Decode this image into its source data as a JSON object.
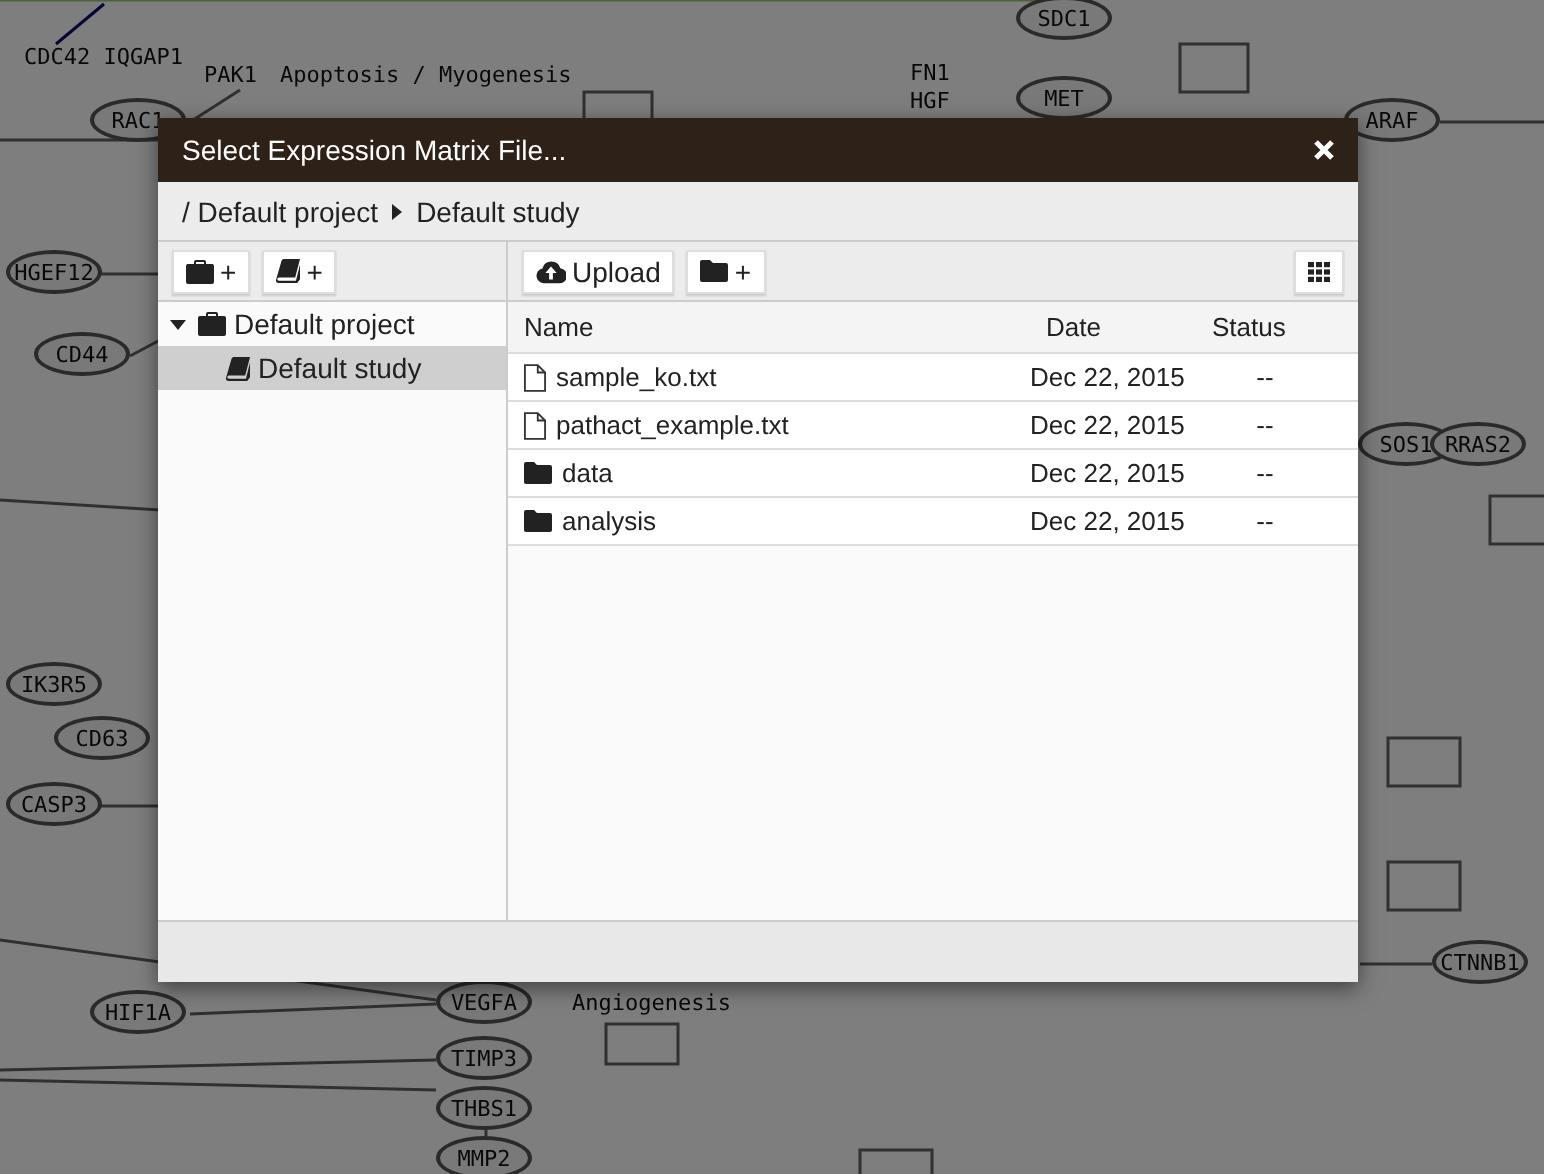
{
  "background": {
    "nodes": [
      {
        "label": "CDC42 IQGAP1",
        "kind": "text"
      },
      {
        "label": "PAK1",
        "kind": "text"
      },
      {
        "label": "Apoptosis / Myogenesis",
        "kind": "text"
      },
      {
        "label": "RAC1",
        "kind": "gene"
      },
      {
        "label": "SDC1",
        "kind": "gene"
      },
      {
        "label": "FN1",
        "kind": "text"
      },
      {
        "label": "HGF",
        "kind": "text"
      },
      {
        "label": "MET",
        "kind": "gene"
      },
      {
        "label": "ARAF",
        "kind": "gene"
      },
      {
        "label": "HGEF12",
        "kind": "gene"
      },
      {
        "label": "CD44",
        "kind": "gene"
      },
      {
        "label": "IK3R5",
        "kind": "gene"
      },
      {
        "label": "CD63",
        "kind": "gene"
      },
      {
        "label": "CASP3",
        "kind": "gene"
      },
      {
        "label": "SOS1",
        "kind": "gene"
      },
      {
        "label": "RRAS2",
        "kind": "gene"
      },
      {
        "label": "CTNNB1",
        "kind": "gene"
      },
      {
        "label": "HIF1A",
        "kind": "gene"
      },
      {
        "label": "VEGFA",
        "kind": "gene"
      },
      {
        "label": "Angiogenesis",
        "kind": "text"
      },
      {
        "label": "TIMP3",
        "kind": "gene"
      },
      {
        "label": "THBS1",
        "kind": "gene"
      },
      {
        "label": "MMP2",
        "kind": "gene"
      }
    ]
  },
  "dialog": {
    "title": "Select Expression Matrix File...",
    "breadcrumb": [
      "/ Default project",
      "Default study"
    ],
    "tree_toolbar": [
      {
        "kind": "project",
        "label": "+"
      },
      {
        "kind": "study",
        "label": "+"
      }
    ],
    "tree": [
      {
        "label": "Default project",
        "kind": "project",
        "expanded": true,
        "selected": false,
        "children": [
          {
            "label": "Default study",
            "kind": "study",
            "selected": true
          }
        ]
      }
    ],
    "file_toolbar": [
      {
        "kind": "upload",
        "label": "Upload"
      },
      {
        "kind": "folder",
        "label": "+"
      }
    ],
    "table": {
      "columns": [
        "Name",
        "Date",
        "Status"
      ],
      "rows": [
        {
          "kind": "file",
          "name": "sample_ko.txt",
          "date": "Dec 22, 2015",
          "status": "--"
        },
        {
          "kind": "file",
          "name": "pathact_example.txt",
          "date": "Dec 22, 2015",
          "status": "--"
        },
        {
          "kind": "folder",
          "name": "data",
          "date": "Dec 22, 2015",
          "status": "--"
        },
        {
          "kind": "folder",
          "name": "analysis",
          "date": "Dec 22, 2015",
          "status": "--"
        }
      ]
    }
  }
}
